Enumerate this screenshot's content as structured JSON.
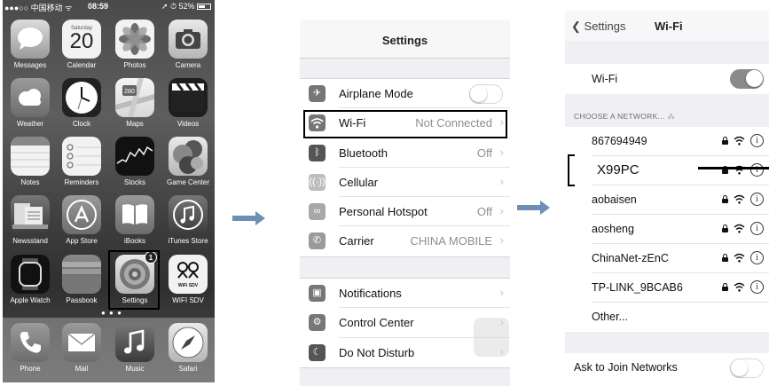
{
  "home": {
    "status": {
      "carrier": "●●●○○ 中国移动 ᯤ",
      "time": "08:59",
      "battery": "➚ ⏱ 52%"
    },
    "calendar": {
      "day_name": "Saturday",
      "day_num": "20"
    },
    "apps": [
      {
        "label": "Messages"
      },
      {
        "label": "Calendar"
      },
      {
        "label": "Photos"
      },
      {
        "label": "Camera"
      },
      {
        "label": "Weather"
      },
      {
        "label": "Clock"
      },
      {
        "label": "Maps"
      },
      {
        "label": "Videos"
      },
      {
        "label": "Notes"
      },
      {
        "label": "Reminders"
      },
      {
        "label": "Stocks"
      },
      {
        "label": "Game Center"
      },
      {
        "label": "Newsstand"
      },
      {
        "label": "App Store"
      },
      {
        "label": "iBooks"
      },
      {
        "label": "iTunes Store"
      },
      {
        "label": "Apple Watch"
      },
      {
        "label": "Passbook"
      },
      {
        "label": "Settings"
      },
      {
        "label": "WIFI SDV"
      }
    ],
    "settings_badge": "1",
    "wifisdv_icon_text": "WiFi SDV",
    "maps_sign": "280",
    "dock": [
      {
        "label": "Phone"
      },
      {
        "label": "Mail"
      },
      {
        "label": "Music"
      },
      {
        "label": "Safari"
      }
    ]
  },
  "settings": {
    "title": "Settings",
    "rows": [
      {
        "label": "Airplane Mode",
        "value": ""
      },
      {
        "label": "Wi-Fi",
        "value": "Not Connected"
      },
      {
        "label": "Bluetooth",
        "value": "Off"
      },
      {
        "label": "Cellular",
        "value": ""
      },
      {
        "label": "Personal Hotspot",
        "value": "Off"
      },
      {
        "label": "Carrier",
        "value": "CHINA MOBILE"
      },
      {
        "label": "Notifications",
        "value": ""
      },
      {
        "label": "Control Center",
        "value": ""
      },
      {
        "label": "Do Not Disturb",
        "value": ""
      }
    ]
  },
  "wifi": {
    "back_label": "Settings",
    "title": "Wi-Fi",
    "toggle_label": "Wi-Fi",
    "section_header": "CHOOSE A NETWORK...",
    "networks": [
      "867694949",
      "X99PC",
      "aobaisen",
      "aosheng",
      "ChinaNet-zEnC",
      "TP-LINK_9BCAB6"
    ],
    "other_label": "Other...",
    "ask_label": "Ask to Join Networks"
  },
  "colors": {
    "highlight": "#000000",
    "toggle_on": "#8a8a8a",
    "arrow": "#6e8eb5"
  },
  "icons": [
    "wifi-icon",
    "lock-icon",
    "info-icon",
    "chevron-right-icon",
    "airplane-icon",
    "bluetooth-icon"
  ]
}
